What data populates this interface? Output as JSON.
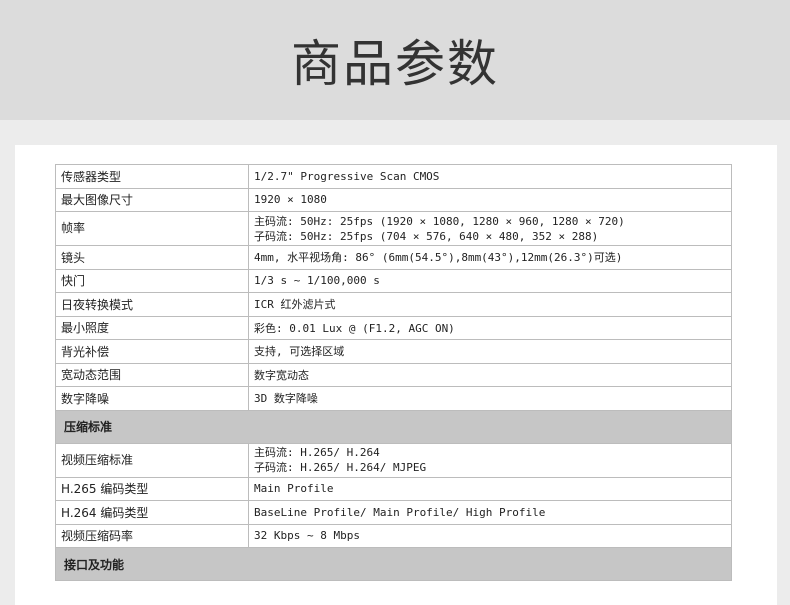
{
  "header": {
    "title": "商品参数"
  },
  "rows": [
    {
      "label": "传感器类型",
      "value": "1/2.7\" Progressive Scan CMOS"
    },
    {
      "label": "最大图像尺寸",
      "value": "1920 × 1080"
    },
    {
      "label": "帧率",
      "lines": [
        "主码流: 50Hz: 25fps (1920 × 1080, 1280 × 960, 1280 × 720)",
        "子码流: 50Hz: 25fps (704 × 576, 640 × 480, 352 × 288)"
      ]
    },
    {
      "label": "镜头",
      "value": "4mm, 水平视场角: 86° (6mm(54.5°),8mm(43°),12mm(26.3°)可选)"
    },
    {
      "label": "快门",
      "value": "1/3 s ~ 1/100,000 s"
    },
    {
      "label": "日夜转换模式",
      "value": "ICR 红外滤片式"
    },
    {
      "label": "最小照度",
      "value": "彩色: 0.01 Lux @ (F1.2, AGC ON)"
    },
    {
      "label": "背光补偿",
      "value": "支持, 可选择区域"
    },
    {
      "label": "宽动态范围",
      "value": "数字宽动态"
    },
    {
      "label": "数字降噪",
      "value": "3D 数字降噪"
    }
  ],
  "section_compression": {
    "title": "压缩标准"
  },
  "rows2": [
    {
      "label": "视频压缩标准",
      "lines": [
        "主码流: H.265/ H.264",
        "子码流: H.265/ H.264/ MJPEG"
      ]
    },
    {
      "label": "H.265 编码类型",
      "value": "Main Profile"
    },
    {
      "label": "H.264 编码类型",
      "value": "BaseLine Profile/ Main Profile/ High Profile"
    },
    {
      "label": "视频压缩码率",
      "value": "32 Kbps ~ 8 Mbps"
    }
  ],
  "section_interface": {
    "title": "接口及功能"
  }
}
